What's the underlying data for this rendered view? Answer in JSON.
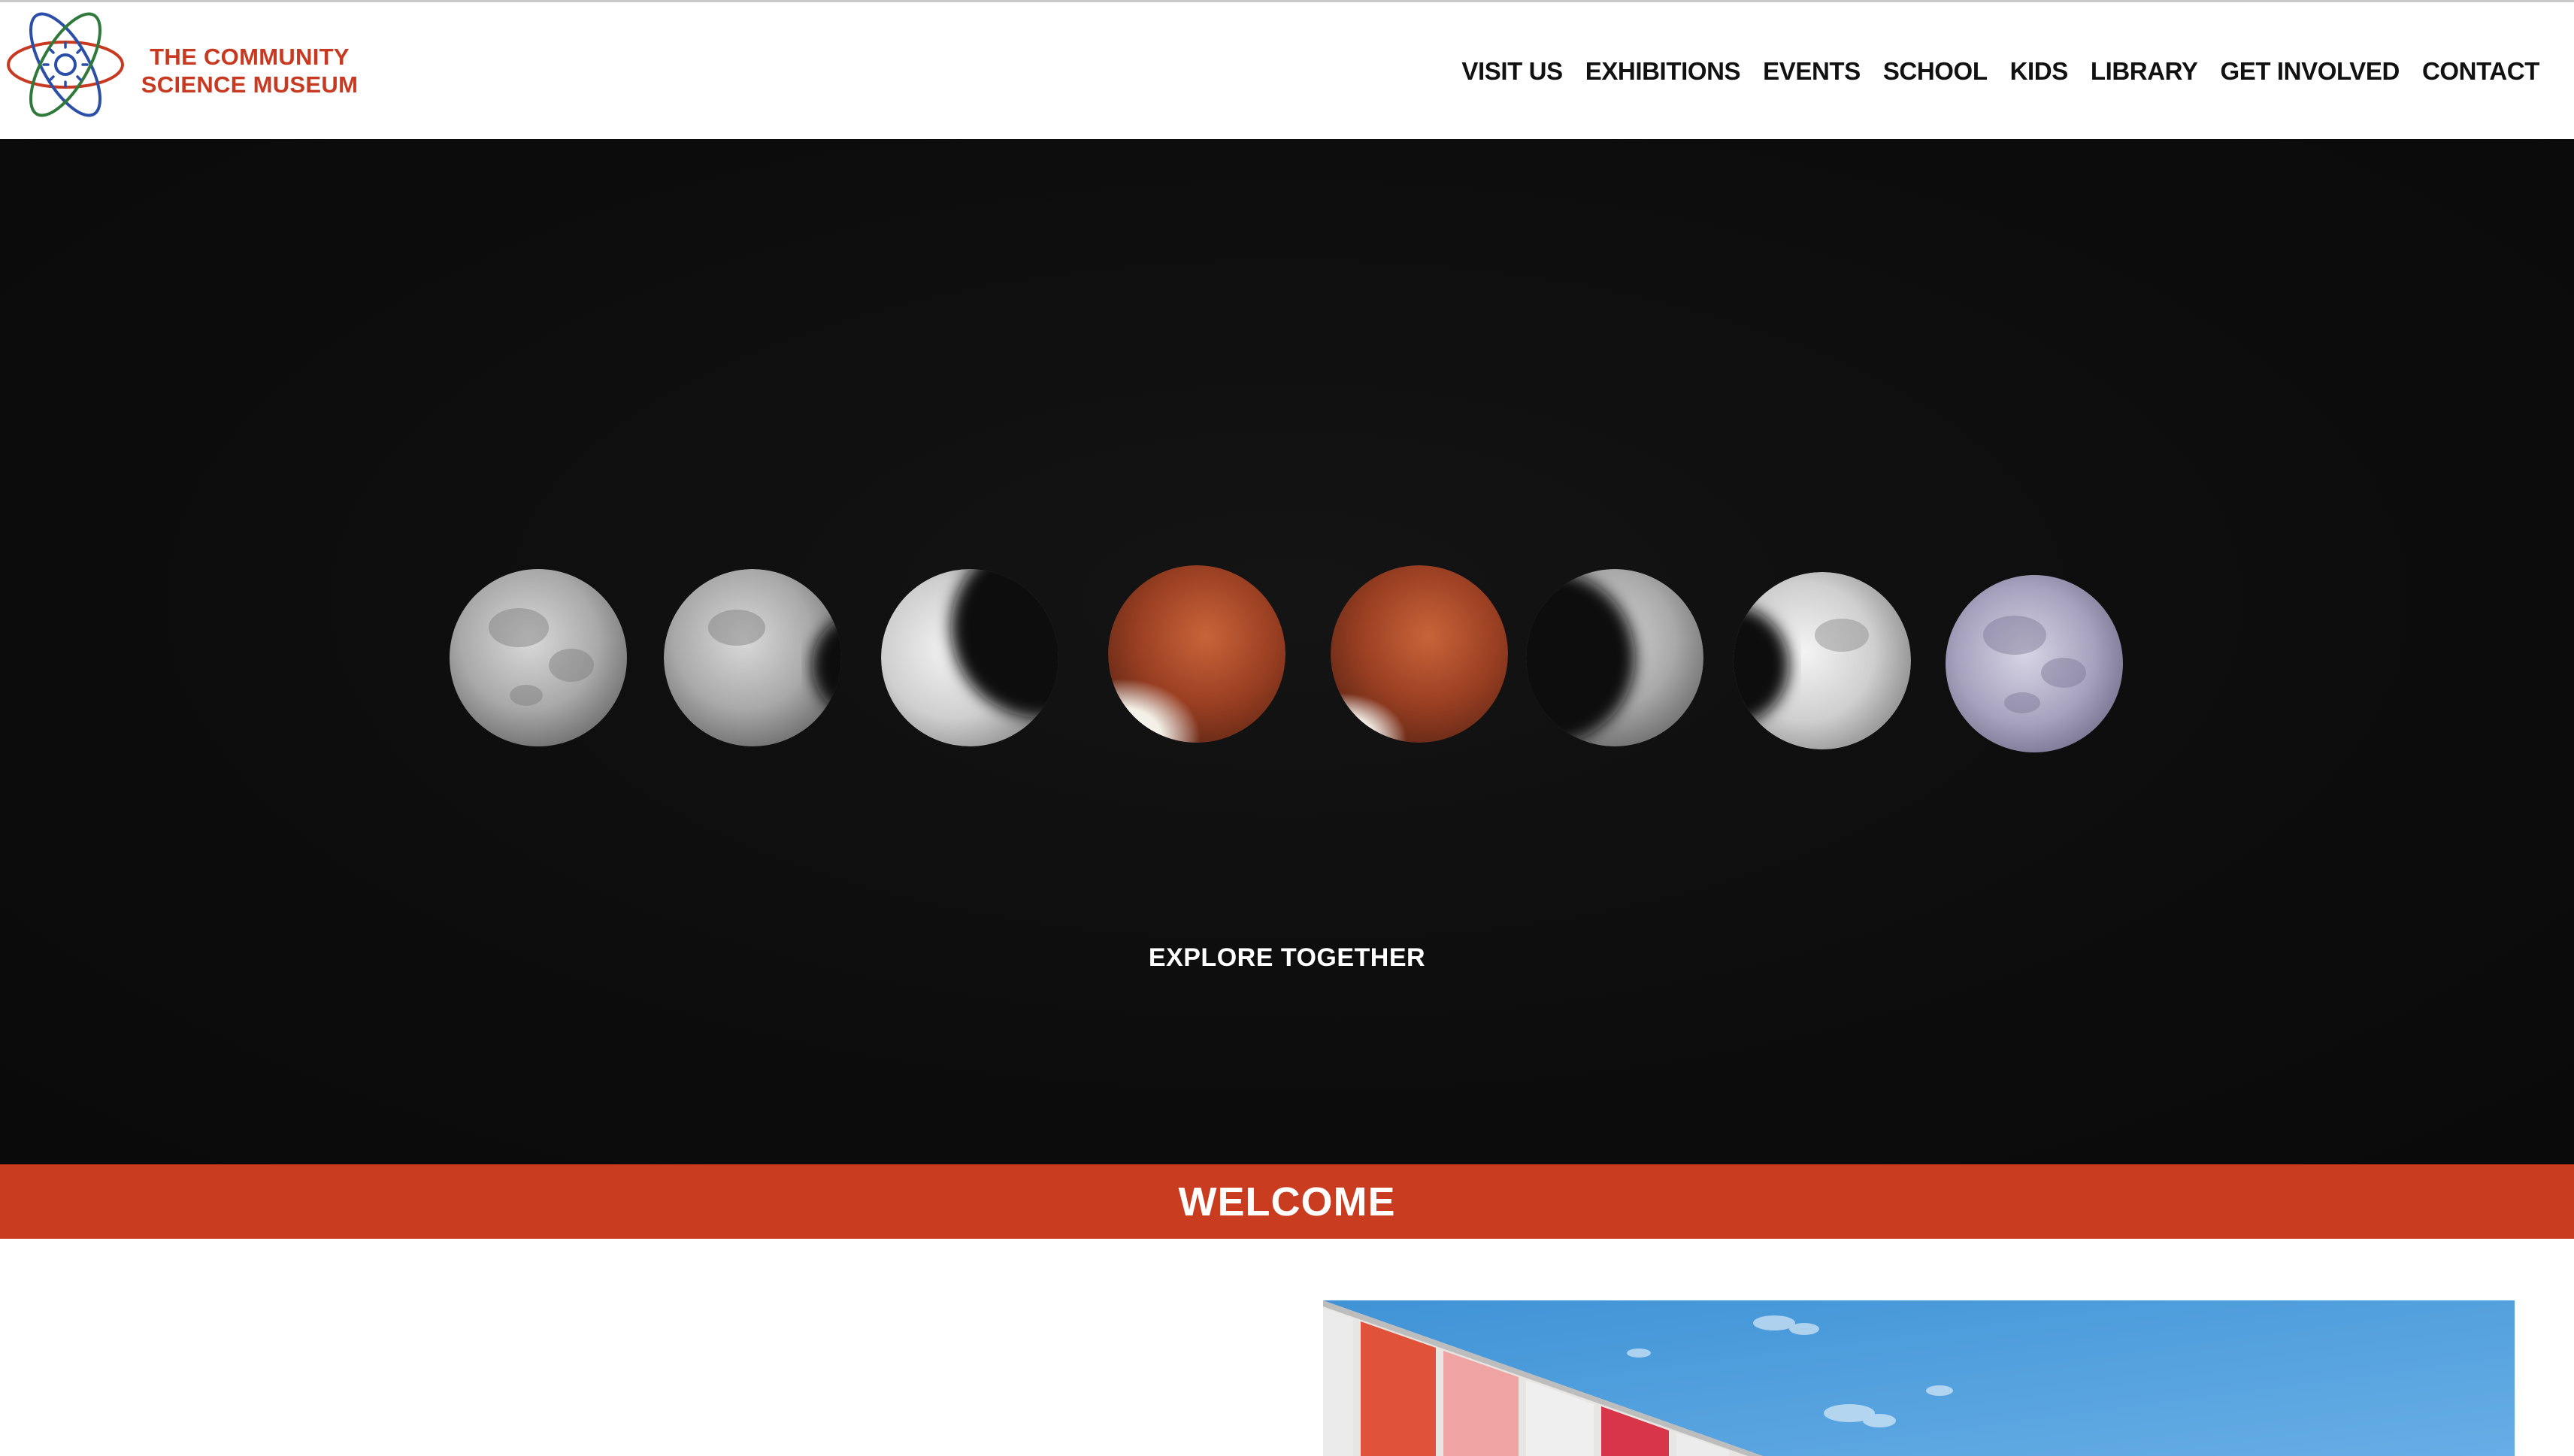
{
  "site": {
    "name_line1": "THE COMMUNITY",
    "name_line2": "SCIENCE MUSEUM"
  },
  "nav": {
    "items": [
      {
        "id": "visit-us",
        "label": "VISIT US"
      },
      {
        "id": "exhibitions",
        "label": "EXHIBITIONS"
      },
      {
        "id": "events",
        "label": "EVENTS"
      },
      {
        "id": "school",
        "label": "SCHOOL"
      },
      {
        "id": "kids",
        "label": "KIDS"
      },
      {
        "id": "library",
        "label": "LIBRARY"
      },
      {
        "id": "get-involved",
        "label": "GET INVOLVED"
      },
      {
        "id": "contact",
        "label": "CONTACT"
      }
    ]
  },
  "hero": {
    "tagline": "EXPLORE TOGETHER",
    "image_subject": "lunar eclipse phases sequence"
  },
  "welcome": {
    "heading": "WELCOME"
  },
  "colors": {
    "brand_red": "#c93c20",
    "logo_red": "#c73a21",
    "logo_blue": "#2b4fa8",
    "logo_green": "#2f7a3a",
    "nav_text": "#111111",
    "hero_bg": "#0d0d0d"
  },
  "icons": {
    "logo": "atom-sun-icon"
  }
}
